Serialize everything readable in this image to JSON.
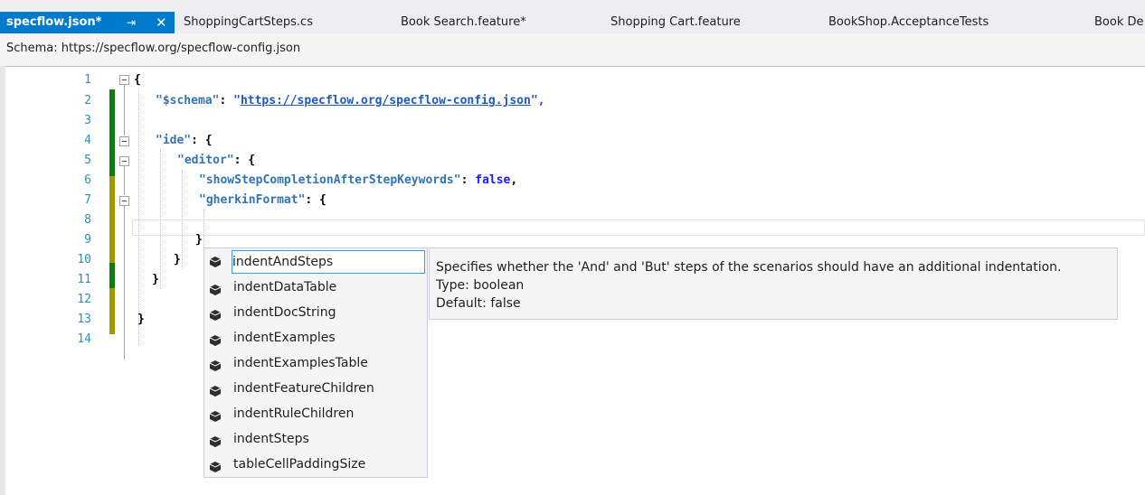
{
  "tabs": [
    {
      "label": "specflow.json*",
      "active": true
    },
    {
      "label": "ShoppingCartSteps.cs"
    },
    {
      "label": "Book Search.feature*"
    },
    {
      "label": "Shopping Cart.feature"
    },
    {
      "label": "BookShop.AcceptanceTests"
    },
    {
      "label": "Book De"
    }
  ],
  "tab_pin_icon": "pin-icon",
  "tab_close_icon": "close-icon",
  "schema_bar": {
    "label": "Schema:",
    "url": "https://specflow.org/specflow-config.json"
  },
  "line_numbers": [
    "1",
    "2",
    "3",
    "4",
    "5",
    "6",
    "7",
    "8",
    "9",
    "10",
    "11",
    "12",
    "13",
    "14"
  ],
  "code": {
    "l1": "{",
    "l2_key": "\"$schema\"",
    "l2_colon": ": ",
    "l2_q1": "\"",
    "l2_url": "https://specflow.org/specflow-config.json",
    "l2_q2": "\",",
    "l4_key": "\"ide\"",
    "l4_rest": ": {",
    "l5_key": "\"editor\"",
    "l5_rest": ": {",
    "l6_key": "\"showStepCompletionAfterStepKeywords\"",
    "l6_colon": ": ",
    "l6_val": "false",
    "l6_comma": ",",
    "l7_key": "\"gherkinFormat\"",
    "l7_rest": ": {",
    "l9": "}",
    "l10": "}",
    "l11": "}",
    "l13": "}"
  },
  "change_bar_colors": {
    "saved": "#107c10",
    "unsaved": "#a69500"
  },
  "completion_items": [
    "indentAndSteps",
    "indentDataTable",
    "indentDocString",
    "indentExamples",
    "indentExamplesTable",
    "indentFeatureChildren",
    "indentRuleChildren",
    "indentSteps",
    "tableCellPaddingSize"
  ],
  "completion_icon": "property-icon",
  "tooltip": {
    "description": "Specifies whether the 'And' and 'But' steps of the scenarios should have an additional indentation.",
    "type": "Type: boolean",
    "default": "Default: false"
  }
}
